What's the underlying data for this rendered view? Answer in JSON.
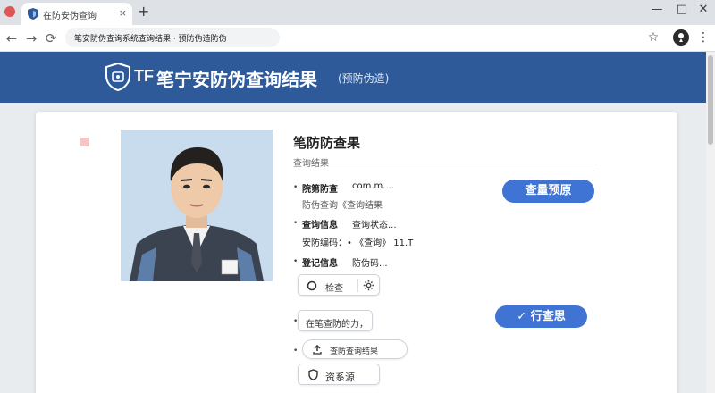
{
  "browser": {
    "tab_title": "在防安伪查询",
    "tab_close": "×",
    "new_tab": "+",
    "window_controls": [
      "—",
      "□",
      "✕"
    ],
    "address": "笔安防伪查询系统查询结果 · 预防伪造防伪",
    "nav": {
      "back": "←",
      "forward": "→",
      "reload": "⟳"
    },
    "bookmark_star": "☆",
    "menu": "⋮"
  },
  "header": {
    "brand": "TF",
    "title": "笔宁安防伪查询结果",
    "subtitle": "(预防伪造)"
  },
  "result": {
    "title": "笔防防查果",
    "subtitle": "查询结果",
    "rows": [
      {
        "bullet": "•",
        "label": "院第防查",
        "value": "com.m....",
        "detail": "防伪查询《查询结果"
      },
      {
        "bullet": "•",
        "label": "查询信息",
        "value": "查询状态...",
        "detail": "安防编码：• 《查询》 11.T"
      },
      {
        "bullet": "•",
        "label": "登记信息",
        "value": "防伪码..."
      }
    ],
    "primary_button": "查量预原",
    "control_1": {
      "label": "检查",
      "left_icon": "circle-icon",
      "right_icon": "gear-icon"
    },
    "control_2": "在笔查防的力，",
    "verify_button": "行查思",
    "control_3": "查防查询结果",
    "control_4": "资系源"
  },
  "colors": {
    "banner": "#2e5a9a",
    "accent": "#3f74d4"
  }
}
